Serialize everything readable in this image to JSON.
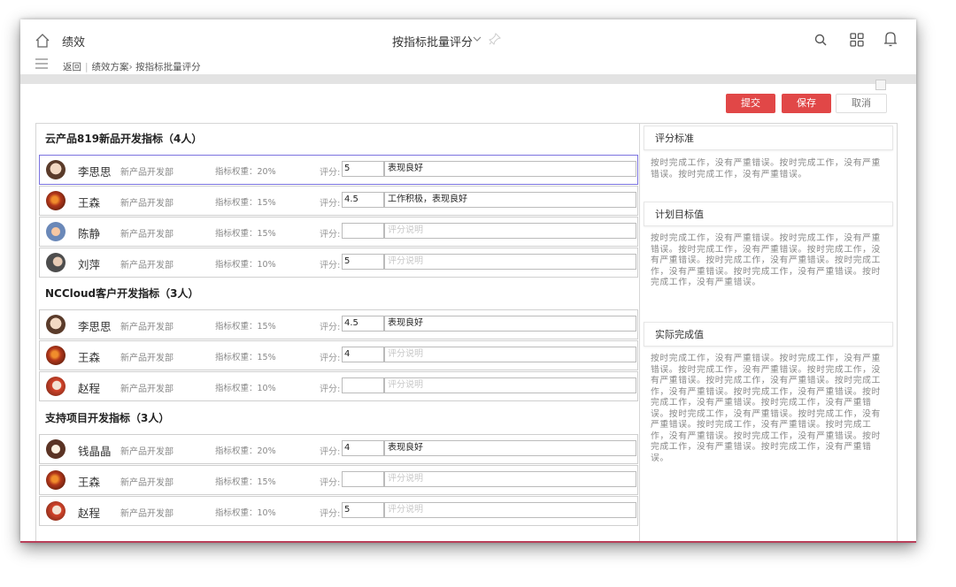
{
  "header": {
    "app_title": "绩效",
    "center_title": "按指标批量评分",
    "icons": [
      "home-icon",
      "chevron-down-icon",
      "pin-icon",
      "search-icon",
      "grid-icon",
      "bell-icon",
      "menu-icon"
    ]
  },
  "breadcrumb": {
    "back": "返回",
    "plan": "绩效方案",
    "current": "按指标批量评分"
  },
  "actions": {
    "submit": "提交",
    "save": "保存",
    "cancel": "取消"
  },
  "colors": {
    "primary_button": "#e14747",
    "selected_row_border": "#7b73e0"
  },
  "groups": [
    {
      "title": "云产品819新品开发指标（4人）",
      "rows": [
        {
          "name": "李思思",
          "dept": "新产品开发部",
          "weight": "指标权重：20%",
          "score_label": "评分:",
          "score": "5",
          "comment": "表现良好",
          "comment_placeholder": "",
          "avatar": "av1"
        },
        {
          "name": "王森",
          "dept": "新产品开发部",
          "weight": "指标权重：15%",
          "score_label": "评分:",
          "score": "4.5",
          "comment": "工作积极，表现良好",
          "comment_placeholder": "",
          "avatar": "av2"
        },
        {
          "name": "陈静",
          "dept": "新产品开发部",
          "weight": "指标权重：15%",
          "score_label": "评分:",
          "score": "",
          "comment": "",
          "comment_placeholder": "评分说明",
          "avatar": "av3"
        },
        {
          "name": "刘萍",
          "dept": "新产品开发部",
          "weight": "指标权重：10%",
          "score_label": "评分:",
          "score": "5",
          "comment": "",
          "comment_placeholder": "评分说明",
          "avatar": "av4"
        }
      ]
    },
    {
      "title": "NCCloud客户开发指标（3人）",
      "rows": [
        {
          "name": "李思思",
          "dept": "新产品开发部",
          "weight": "指标权重：15%",
          "score_label": "评分:",
          "score": "4.5",
          "comment": "表现良好",
          "comment_placeholder": "",
          "avatar": "av1"
        },
        {
          "name": "王森",
          "dept": "新产品开发部",
          "weight": "指标权重：15%",
          "score_label": "评分:",
          "score": "4",
          "comment": "",
          "comment_placeholder": "评分说明",
          "avatar": "av2"
        },
        {
          "name": "赵程",
          "dept": "新产品开发部",
          "weight": "指标权重：10%",
          "score_label": "评分:",
          "score": "",
          "comment": "",
          "comment_placeholder": "评分说明",
          "avatar": "av5"
        }
      ]
    },
    {
      "title": "支持项目开发指标（3人）",
      "rows": [
        {
          "name": "钱晶晶",
          "dept": "新产品开发部",
          "weight": "指标权重：20%",
          "score_label": "评分:",
          "score": "4",
          "comment": "表现良好",
          "comment_placeholder": "",
          "avatar": "av6"
        },
        {
          "name": "王森",
          "dept": "新产品开发部",
          "weight": "指标权重：15%",
          "score_label": "评分:",
          "score": "",
          "comment": "",
          "comment_placeholder": "评分说明",
          "avatar": "av2"
        },
        {
          "name": "赵程",
          "dept": "新产品开发部",
          "weight": "指标权重：10%",
          "score_label": "评分:",
          "score": "5",
          "comment": "",
          "comment_placeholder": "评分说明",
          "avatar": "av5"
        }
      ]
    }
  ],
  "side": {
    "standard_title": "评分标准",
    "standard_text": "按时完成工作，没有严重错误。按时完成工作，没有严重错误。按时完成工作，没有严重错误。",
    "target_title": "计划目标值",
    "target_text": "按时完成工作，没有严重错误。按时完成工作，没有严重错误。按时完成工作，没有严重错误。按时完成工作，没有严重错误。按时完成工作，没有严重错误。按时完成工作，没有严重错误。按时完成工作，没有严重错误。按时完成工作，没有严重错误。",
    "actual_title": "实际完成值",
    "actual_text": "按时完成工作，没有严重错误。按时完成工作，没有严重错误。按时完成工作，没有严重错误。按时完成工作，没有严重错误。按时完成工作，没有严重错误。按时完成工作，没有严重错误。按时完成工作，没有严重错误。按时完成工作，没有严重错误。按时完成工作，没有严重错误。按时完成工作，没有严重错误。按时完成工作，没有严重错误。按时完成工作，没有严重错误。按时完成工作，没有严重错误。按时完成工作，没有严重错误。按时完成工作，没有严重错误。按时完成工作，没有严重错误。"
  }
}
